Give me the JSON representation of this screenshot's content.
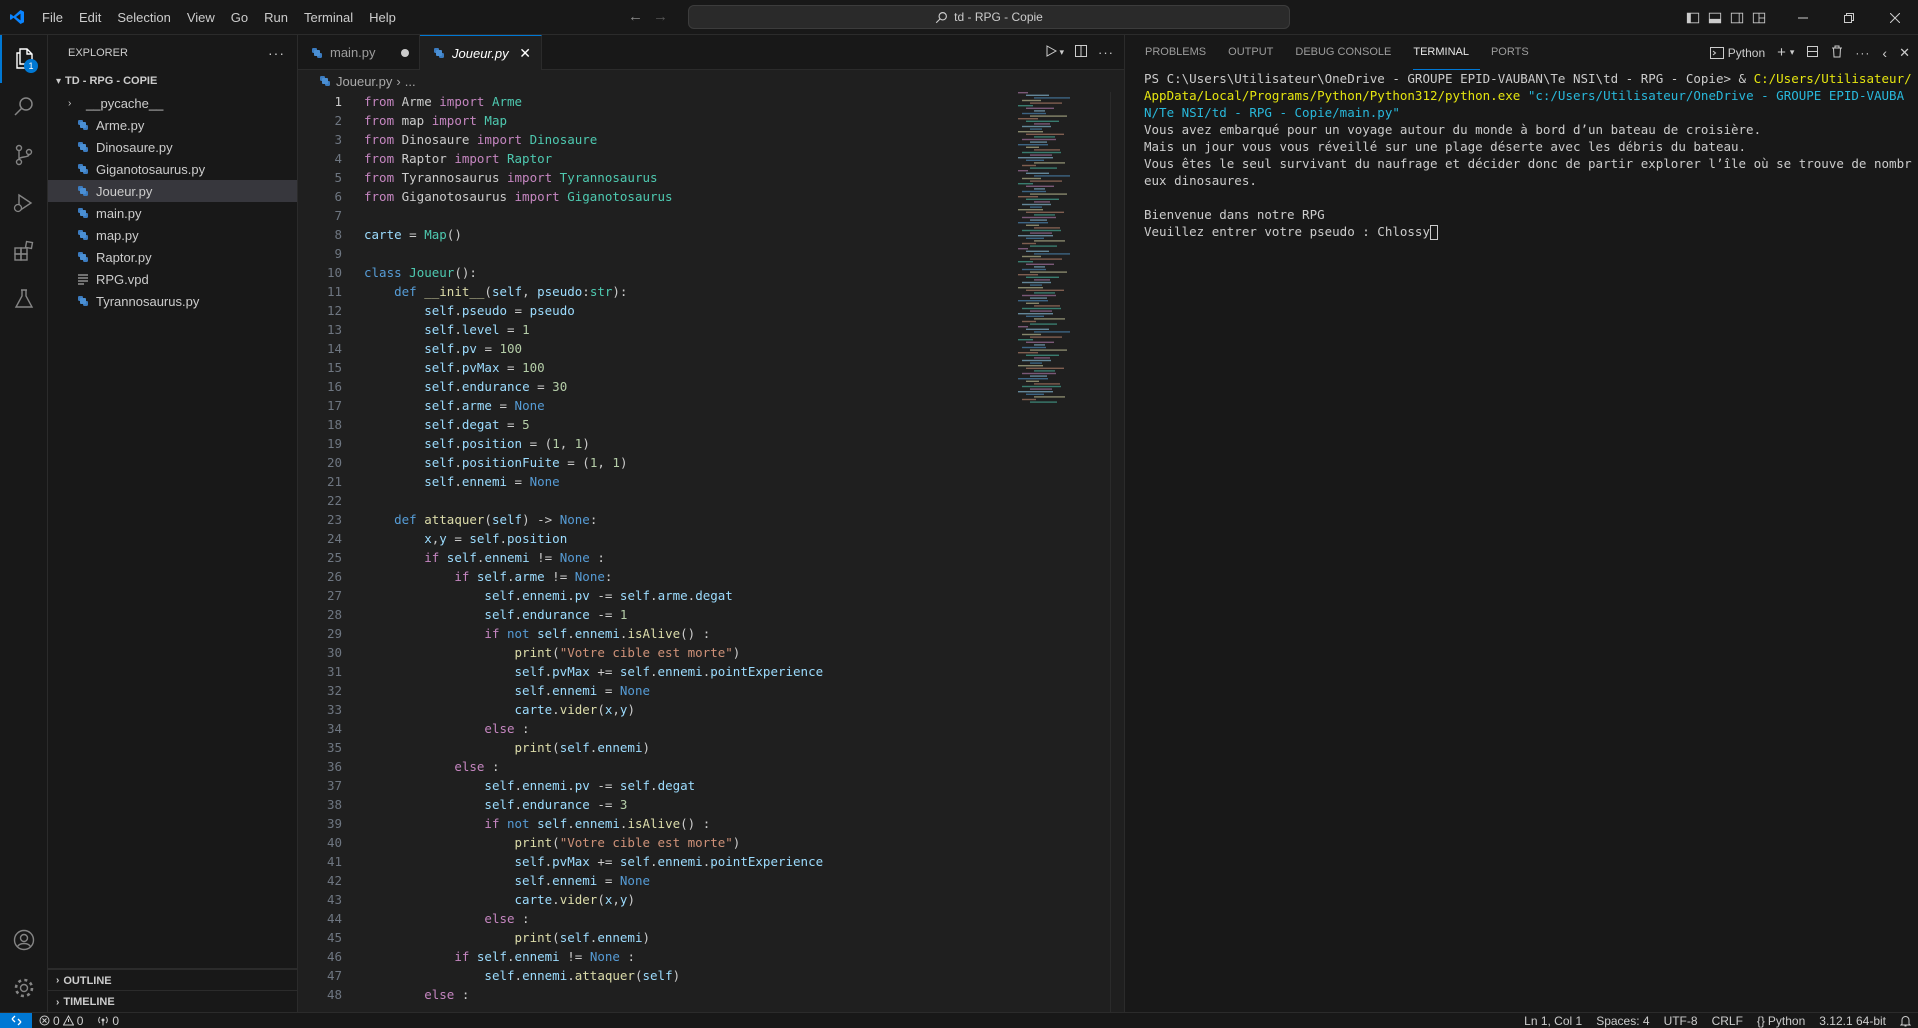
{
  "titlebar": {
    "menus": [
      "File",
      "Edit",
      "Selection",
      "View",
      "Go",
      "Run",
      "Terminal",
      "Help"
    ],
    "search_text": "td - RPG - Copie"
  },
  "activity": {
    "explorer_badge": "1"
  },
  "sidebar": {
    "title": "EXPLORER",
    "project": "TD - RPG - COPIE",
    "folder": "__pycache__",
    "files": [
      "Arme.py",
      "Dinosaure.py",
      "Giganotosaurus.py",
      "Joueur.py",
      "main.py",
      "map.py",
      "Raptor.py",
      "RPG.vpd",
      "Tyrannosaurus.py"
    ],
    "outline": "OUTLINE",
    "timeline": "TIMELINE"
  },
  "tabs": [
    {
      "label": "main.py",
      "state": "modified"
    },
    {
      "label": "Joueur.py",
      "state": "active"
    }
  ],
  "breadcrumb": {
    "file": "Joueur.py",
    "more": "..."
  },
  "code": [
    [
      [
        "k",
        "from"
      ],
      [
        "p",
        " Arme "
      ],
      [
        "k",
        "import"
      ],
      [
        "c",
        " Arme"
      ]
    ],
    [
      [
        "k",
        "from"
      ],
      [
        "p",
        " map "
      ],
      [
        "k",
        "import"
      ],
      [
        "c",
        " Map"
      ]
    ],
    [
      [
        "k",
        "from"
      ],
      [
        "p",
        " Dinosaure "
      ],
      [
        "k",
        "import"
      ],
      [
        "c",
        " Dinosaure"
      ]
    ],
    [
      [
        "k",
        "from"
      ],
      [
        "p",
        " Raptor "
      ],
      [
        "k",
        "import"
      ],
      [
        "c",
        " Raptor"
      ]
    ],
    [
      [
        "k",
        "from"
      ],
      [
        "p",
        " Tyrannosaurus "
      ],
      [
        "k",
        "import"
      ],
      [
        "c",
        " Tyrannosaurus"
      ]
    ],
    [
      [
        "k",
        "from"
      ],
      [
        "p",
        " Giganotosaurus "
      ],
      [
        "k",
        "import"
      ],
      [
        "c",
        " Giganotosaurus"
      ]
    ],
    [],
    [
      [
        "v",
        "carte"
      ],
      [
        "p",
        " = "
      ],
      [
        "c",
        "Map"
      ],
      [
        "p",
        "()"
      ]
    ],
    [],
    [
      [
        "kb",
        "class"
      ],
      [
        "c",
        " Joueur"
      ],
      [
        "p",
        "():"
      ]
    ],
    [
      [
        "p",
        "    "
      ],
      [
        "kb",
        "def"
      ],
      [
        "f",
        " __init__"
      ],
      [
        "p",
        "("
      ],
      [
        "v",
        "self"
      ],
      [
        "p",
        ", "
      ],
      [
        "v",
        "pseudo"
      ],
      [
        "p",
        ":"
      ],
      [
        "c",
        "str"
      ],
      [
        "p",
        "):"
      ]
    ],
    [
      [
        "p",
        "        "
      ],
      [
        "v",
        "self"
      ],
      [
        "p",
        "."
      ],
      [
        "v",
        "pseudo"
      ],
      [
        "p",
        " = "
      ],
      [
        "v",
        "pseudo"
      ]
    ],
    [
      [
        "p",
        "        "
      ],
      [
        "v",
        "self"
      ],
      [
        "p",
        "."
      ],
      [
        "v",
        "level"
      ],
      [
        "p",
        " = "
      ],
      [
        "n",
        "1"
      ]
    ],
    [
      [
        "p",
        "        "
      ],
      [
        "v",
        "self"
      ],
      [
        "p",
        "."
      ],
      [
        "v",
        "pv"
      ],
      [
        "p",
        " = "
      ],
      [
        "n",
        "100"
      ]
    ],
    [
      [
        "p",
        "        "
      ],
      [
        "v",
        "self"
      ],
      [
        "p",
        "."
      ],
      [
        "v",
        "pvMax"
      ],
      [
        "p",
        " = "
      ],
      [
        "n",
        "100"
      ]
    ],
    [
      [
        "p",
        "        "
      ],
      [
        "v",
        "self"
      ],
      [
        "p",
        "."
      ],
      [
        "v",
        "endurance"
      ],
      [
        "p",
        " = "
      ],
      [
        "n",
        "30"
      ]
    ],
    [
      [
        "p",
        "        "
      ],
      [
        "v",
        "self"
      ],
      [
        "p",
        "."
      ],
      [
        "v",
        "arme"
      ],
      [
        "p",
        " = "
      ],
      [
        "kb",
        "None"
      ]
    ],
    [
      [
        "p",
        "        "
      ],
      [
        "v",
        "self"
      ],
      [
        "p",
        "."
      ],
      [
        "v",
        "degat"
      ],
      [
        "p",
        " = "
      ],
      [
        "n",
        "5"
      ]
    ],
    [
      [
        "p",
        "        "
      ],
      [
        "v",
        "self"
      ],
      [
        "p",
        "."
      ],
      [
        "v",
        "position"
      ],
      [
        "p",
        " = ("
      ],
      [
        "n",
        "1"
      ],
      [
        "p",
        ", "
      ],
      [
        "n",
        "1"
      ],
      [
        "p",
        ")"
      ]
    ],
    [
      [
        "p",
        "        "
      ],
      [
        "v",
        "self"
      ],
      [
        "p",
        "."
      ],
      [
        "v",
        "positionFuite"
      ],
      [
        "p",
        " = ("
      ],
      [
        "n",
        "1"
      ],
      [
        "p",
        ", "
      ],
      [
        "n",
        "1"
      ],
      [
        "p",
        ")"
      ]
    ],
    [
      [
        "p",
        "        "
      ],
      [
        "v",
        "self"
      ],
      [
        "p",
        "."
      ],
      [
        "v",
        "ennemi"
      ],
      [
        "p",
        " = "
      ],
      [
        "kb",
        "None"
      ]
    ],
    [],
    [
      [
        "p",
        "    "
      ],
      [
        "kb",
        "def"
      ],
      [
        "f",
        " attaquer"
      ],
      [
        "p",
        "("
      ],
      [
        "v",
        "self"
      ],
      [
        "p",
        ") -> "
      ],
      [
        "kb",
        "None"
      ],
      [
        "p",
        ":"
      ]
    ],
    [
      [
        "p",
        "        "
      ],
      [
        "v",
        "x"
      ],
      [
        "p",
        ","
      ],
      [
        "v",
        "y"
      ],
      [
        "p",
        " = "
      ],
      [
        "v",
        "self"
      ],
      [
        "p",
        "."
      ],
      [
        "v",
        "position"
      ]
    ],
    [
      [
        "p",
        "        "
      ],
      [
        "k",
        "if"
      ],
      [
        "v",
        " self"
      ],
      [
        "p",
        "."
      ],
      [
        "v",
        "ennemi"
      ],
      [
        "p",
        " != "
      ],
      [
        "kb",
        "None"
      ],
      [
        "p",
        " :"
      ]
    ],
    [
      [
        "p",
        "            "
      ],
      [
        "k",
        "if"
      ],
      [
        "v",
        " self"
      ],
      [
        "p",
        "."
      ],
      [
        "v",
        "arme"
      ],
      [
        "p",
        " != "
      ],
      [
        "kb",
        "None"
      ],
      [
        "p",
        ":"
      ]
    ],
    [
      [
        "p",
        "                "
      ],
      [
        "v",
        "self"
      ],
      [
        "p",
        "."
      ],
      [
        "v",
        "ennemi"
      ],
      [
        "p",
        "."
      ],
      [
        "v",
        "pv"
      ],
      [
        "p",
        " -= "
      ],
      [
        "v",
        "self"
      ],
      [
        "p",
        "."
      ],
      [
        "v",
        "arme"
      ],
      [
        "p",
        "."
      ],
      [
        "v",
        "degat"
      ]
    ],
    [
      [
        "p",
        "                "
      ],
      [
        "v",
        "self"
      ],
      [
        "p",
        "."
      ],
      [
        "v",
        "endurance"
      ],
      [
        "p",
        " -= "
      ],
      [
        "n",
        "1"
      ]
    ],
    [
      [
        "p",
        "                "
      ],
      [
        "k",
        "if"
      ],
      [
        "kb",
        " not"
      ],
      [
        "v",
        " self"
      ],
      [
        "p",
        "."
      ],
      [
        "v",
        "ennemi"
      ],
      [
        "p",
        "."
      ],
      [
        "f",
        "isAlive"
      ],
      [
        "p",
        "() :"
      ]
    ],
    [
      [
        "p",
        "                    "
      ],
      [
        "f",
        "print"
      ],
      [
        "p",
        "("
      ],
      [
        "s",
        "\"Votre cible est morte\""
      ],
      [
        "p",
        ")"
      ]
    ],
    [
      [
        "p",
        "                    "
      ],
      [
        "v",
        "self"
      ],
      [
        "p",
        "."
      ],
      [
        "v",
        "pvMax"
      ],
      [
        "p",
        " += "
      ],
      [
        "v",
        "self"
      ],
      [
        "p",
        "."
      ],
      [
        "v",
        "ennemi"
      ],
      [
        "p",
        "."
      ],
      [
        "v",
        "pointExperience"
      ]
    ],
    [
      [
        "p",
        "                    "
      ],
      [
        "v",
        "self"
      ],
      [
        "p",
        "."
      ],
      [
        "v",
        "ennemi"
      ],
      [
        "p",
        " = "
      ],
      [
        "kb",
        "None"
      ]
    ],
    [
      [
        "p",
        "                    "
      ],
      [
        "v",
        "carte"
      ],
      [
        "p",
        "."
      ],
      [
        "f",
        "vider"
      ],
      [
        "p",
        "("
      ],
      [
        "v",
        "x"
      ],
      [
        "p",
        ","
      ],
      [
        "v",
        "y"
      ],
      [
        "p",
        ")"
      ]
    ],
    [
      [
        "p",
        "                "
      ],
      [
        "k",
        "else"
      ],
      [
        "p",
        " :"
      ]
    ],
    [
      [
        "p",
        "                    "
      ],
      [
        "f",
        "print"
      ],
      [
        "p",
        "("
      ],
      [
        "v",
        "self"
      ],
      [
        "p",
        "."
      ],
      [
        "v",
        "ennemi"
      ],
      [
        "p",
        ")"
      ]
    ],
    [
      [
        "p",
        "            "
      ],
      [
        "k",
        "else"
      ],
      [
        "p",
        " :"
      ]
    ],
    [
      [
        "p",
        "                "
      ],
      [
        "v",
        "self"
      ],
      [
        "p",
        "."
      ],
      [
        "v",
        "ennemi"
      ],
      [
        "p",
        "."
      ],
      [
        "v",
        "pv"
      ],
      [
        "p",
        " -= "
      ],
      [
        "v",
        "self"
      ],
      [
        "p",
        "."
      ],
      [
        "v",
        "degat"
      ]
    ],
    [
      [
        "p",
        "                "
      ],
      [
        "v",
        "self"
      ],
      [
        "p",
        "."
      ],
      [
        "v",
        "endurance"
      ],
      [
        "p",
        " -= "
      ],
      [
        "n",
        "3"
      ]
    ],
    [
      [
        "p",
        "                "
      ],
      [
        "k",
        "if"
      ],
      [
        "kb",
        " not"
      ],
      [
        "v",
        " self"
      ],
      [
        "p",
        "."
      ],
      [
        "v",
        "ennemi"
      ],
      [
        "p",
        "."
      ],
      [
        "f",
        "isAlive"
      ],
      [
        "p",
        "() :"
      ]
    ],
    [
      [
        "p",
        "                    "
      ],
      [
        "f",
        "print"
      ],
      [
        "p",
        "("
      ],
      [
        "s",
        "\"Votre cible est morte\""
      ],
      [
        "p",
        ")"
      ]
    ],
    [
      [
        "p",
        "                    "
      ],
      [
        "v",
        "self"
      ],
      [
        "p",
        "."
      ],
      [
        "v",
        "pvMax"
      ],
      [
        "p",
        " += "
      ],
      [
        "v",
        "self"
      ],
      [
        "p",
        "."
      ],
      [
        "v",
        "ennemi"
      ],
      [
        "p",
        "."
      ],
      [
        "v",
        "pointExperience"
      ]
    ],
    [
      [
        "p",
        "                    "
      ],
      [
        "v",
        "self"
      ],
      [
        "p",
        "."
      ],
      [
        "v",
        "ennemi"
      ],
      [
        "p",
        " = "
      ],
      [
        "kb",
        "None"
      ]
    ],
    [
      [
        "p",
        "                    "
      ],
      [
        "v",
        "carte"
      ],
      [
        "p",
        "."
      ],
      [
        "f",
        "vider"
      ],
      [
        "p",
        "("
      ],
      [
        "v",
        "x"
      ],
      [
        "p",
        ","
      ],
      [
        "v",
        "y"
      ],
      [
        "p",
        ")"
      ]
    ],
    [
      [
        "p",
        "                "
      ],
      [
        "k",
        "else"
      ],
      [
        "p",
        " :"
      ]
    ],
    [
      [
        "p",
        "                    "
      ],
      [
        "f",
        "print"
      ],
      [
        "p",
        "("
      ],
      [
        "v",
        "self"
      ],
      [
        "p",
        "."
      ],
      [
        "v",
        "ennemi"
      ],
      [
        "p",
        ")"
      ]
    ],
    [
      [
        "p",
        "            "
      ],
      [
        "k",
        "if"
      ],
      [
        "v",
        " self"
      ],
      [
        "p",
        "."
      ],
      [
        "v",
        "ennemi"
      ],
      [
        "p",
        " != "
      ],
      [
        "kb",
        "None"
      ],
      [
        "p",
        " :"
      ]
    ],
    [
      [
        "p",
        "                "
      ],
      [
        "v",
        "self"
      ],
      [
        "p",
        "."
      ],
      [
        "v",
        "ennemi"
      ],
      [
        "p",
        "."
      ],
      [
        "f",
        "attaquer"
      ],
      [
        "p",
        "("
      ],
      [
        "v",
        "self"
      ],
      [
        "p",
        ")"
      ]
    ],
    [
      [
        "p",
        "        "
      ],
      [
        "k",
        "else"
      ],
      [
        "p",
        " :"
      ]
    ]
  ],
  "panel": {
    "tabs": [
      "PROBLEMS",
      "OUTPUT",
      "DEBUG CONSOLE",
      "TERMINAL",
      "PORTS"
    ],
    "active_tab": "TERMINAL",
    "shell_label": "Python",
    "terminal": {
      "prompt": "PS C:\\Users\\Utilisateur\\OneDrive - GROUPE EPID-VAUBAN\\Te NSI\\td - RPG - Copie> & ",
      "exe": "C:/Users/Utilisateur/AppData/Local/Programs/Python/Python312/python.exe",
      "arg": " \"c:/Users/Utilisateur/OneDrive - GROUPE EPID-VAUBAN/Te NSI/td - RPG - Copie/main.py\"",
      "line1": "Vous avez embarqué pour un voyage autour du monde à bord d’un bateau de croisière.",
      "line2": "Mais un jour vous vous réveillé sur une plage déserte avec les débris du bateau.",
      "line3": "Vous êtes le seul survivant du naufrage et décider donc de partir explorer l’île où se trouve de nombreux dinosaures.",
      "line4": "Bienvenue dans notre RPG",
      "line5": "Veuillez entrer votre pseudo : Chlossy"
    }
  },
  "statusbar": {
    "errors": "0",
    "warnings": "0",
    "ports": "0",
    "position": "Ln 1, Col 1",
    "spaces": "Spaces: 4",
    "encoding": "UTF-8",
    "eol": "CRLF",
    "language": "Python",
    "interpreter": "3.12.1 64-bit"
  },
  "colors": {
    "accent": "#0078d4",
    "editor_bg": "#1f1f1f",
    "chrome_bg": "#181818"
  }
}
